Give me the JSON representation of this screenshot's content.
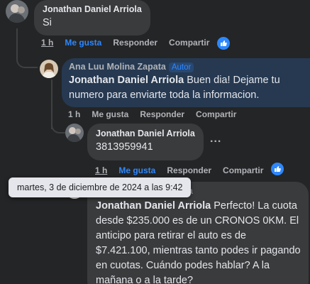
{
  "comments": [
    {
      "author": "Jonathan Daniel Arriola",
      "text": "Si",
      "time": "1 h",
      "like_label": "Me gusta",
      "reply_label": "Responder",
      "share_label": "Compartir"
    },
    {
      "author": "Ana Luu Molina Zapata",
      "badge": "Autor",
      "mention": "Jonathan Daniel Arriola",
      "text": " Buen dia! Dejame tu numero para enviarte toda la informacion.",
      "time": "1 h",
      "like_label": "Me gusta",
      "reply_label": "Responder",
      "share_label": "Compartir"
    },
    {
      "author": "Jonathan Daniel Arriola",
      "text": "3813959941",
      "time": "1 h",
      "like_label": "Me gusta",
      "reply_label": "Responder",
      "share_label": "Compartir"
    },
    {
      "author": "Ana Luu Molina Zapata",
      "mention": "Jonathan Daniel Arriola",
      "text": " Perfecto! La cuota desde $235.000 es de un CRONOS 0KM. El anticipo para retirar el auto es de $7.421.100, mientras tanto podes ir pagando en cuotas. Cuándo podes hablar? A la mañana o a la tarde?"
    }
  ],
  "tooltip": "martes, 3 de diciembre de 2024 a las 9:42",
  "more_label": "...",
  "colors": {
    "background": "#242526",
    "bubble": "#3a3b3c",
    "highlight_bubble": "#263951",
    "accent": "#2d88ff",
    "secondary_text": "#b0b3b8"
  },
  "icons": [
    "avatar",
    "like-icon",
    "more-options-icon"
  ]
}
